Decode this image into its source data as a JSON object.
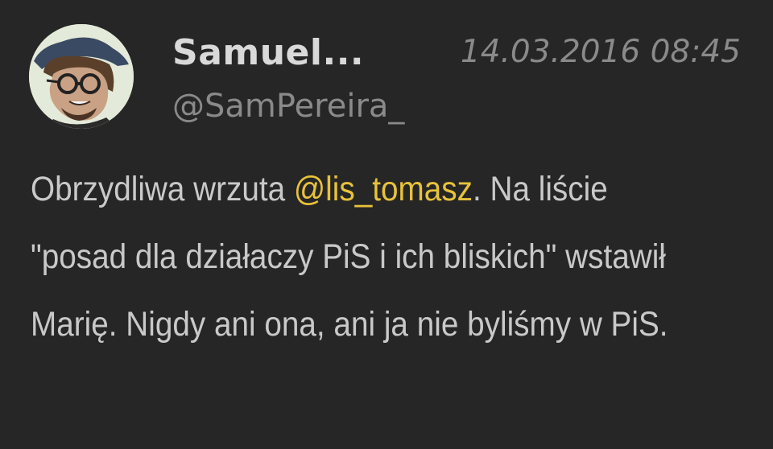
{
  "tweet": {
    "display_name": "Samuel...",
    "handle": "@SamPereira_",
    "timestamp": "14.03.2016 08:45",
    "text_before_mention": "Obrzydliwa wrzuta ",
    "mention": "@lis_tomasz",
    "text_after_mention": ". Na liście \"posad dla działaczy PiS i ich bliskich\" wstawił Marię. Nigdy ani ona, ani ja nie byliśmy w PiS.",
    "avatar_icon": "user-avatar",
    "mention_color": "#e8c23a"
  }
}
